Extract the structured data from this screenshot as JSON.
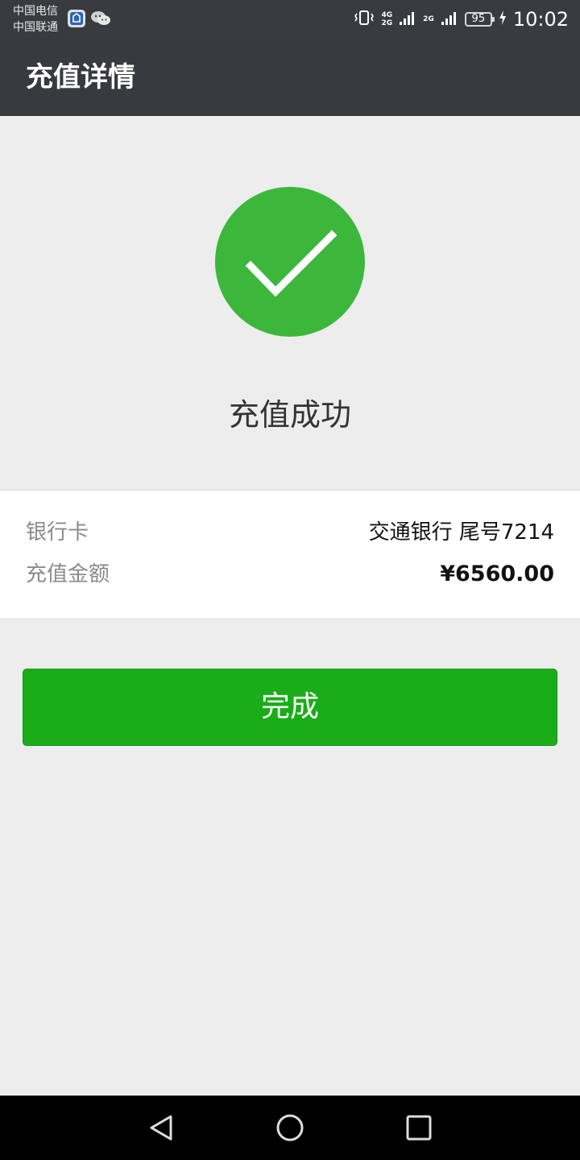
{
  "status_bar": {
    "carrier_1": "中国电信",
    "carrier_2": "中国联通",
    "network_1": "4G",
    "network_2": "2G",
    "network_3": "2G",
    "battery": "95",
    "time": "10:02"
  },
  "header": {
    "title": "充值详情"
  },
  "result": {
    "status_text": "充值成功",
    "icon": "checkmark-circle-icon"
  },
  "details": {
    "bank_label": "银行卡",
    "bank_value": "交通银行 尾号7214",
    "amount_label": "充值金额",
    "amount_value": "¥6560.00"
  },
  "actions": {
    "done_label": "完成"
  },
  "navigation": {
    "back_icon": "back-triangle-icon",
    "home_icon": "home-circle-icon",
    "recents_icon": "recents-square-icon"
  },
  "colors": {
    "success_green": "#3cb73c",
    "button_green": "#1aad19",
    "title_bar": "#393a3f",
    "background": "#ededed"
  }
}
